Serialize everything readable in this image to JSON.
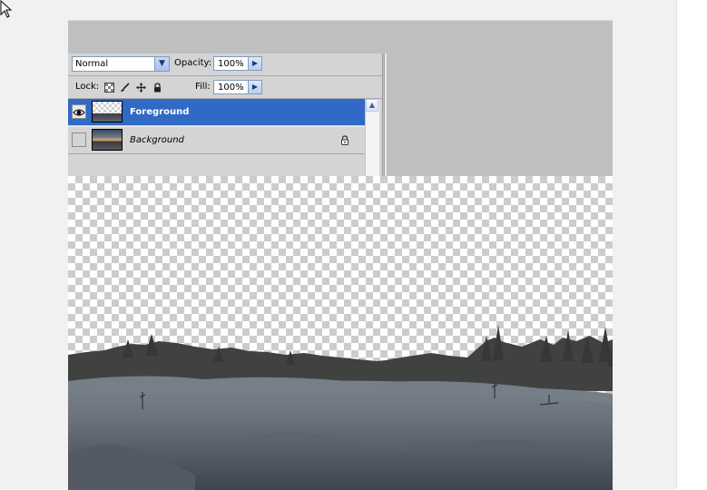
{
  "layers_panel": {
    "blend_mode": "Normal",
    "opacity_label": "Opacity:",
    "opacity_value": "100%",
    "lock_label": "Lock:",
    "fill_label": "Fill:",
    "fill_value": "100%",
    "layers": [
      {
        "name": "Foreground",
        "visible": true,
        "selected": true,
        "locked": false
      },
      {
        "name": "Background",
        "visible": false,
        "selected": false,
        "locked": true
      }
    ]
  },
  "icons": {
    "blend_dropdown": "chevron-down-icon",
    "opacity_stepper": "triangle-right-icon",
    "fill_stepper": "triangle-right-icon",
    "lock_transparent": "checkerboard-icon",
    "lock_pixels": "brush-icon",
    "lock_position": "move-icon",
    "lock_all": "lock-icon",
    "visibility": "eye-icon",
    "scroll_up": "arrow-up-icon",
    "cursor": "mouse-pointer-icon"
  },
  "colors": {
    "selection": "#316ac5",
    "panel_bg": "#d4d4d4",
    "workspace_bg": "#bfbfbf",
    "frame_bg": "#f1f1f1"
  }
}
